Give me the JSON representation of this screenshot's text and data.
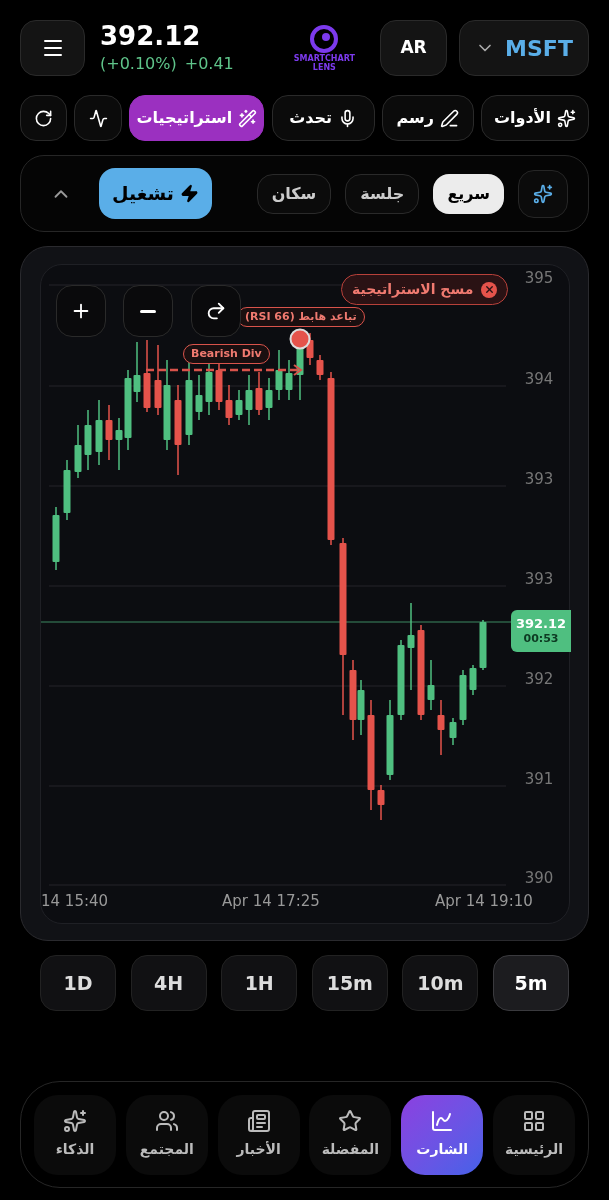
{
  "header": {
    "price": "392.12",
    "change_pct": "(+0.10%)",
    "change": "+0.41",
    "logo": [
      "SMARTCHART",
      "LENS"
    ],
    "language": "AR",
    "symbol": "MSFT"
  },
  "toolbar": [
    {
      "kind": "tools",
      "label": "الأدوات",
      "selected": false
    },
    {
      "kind": "draw",
      "label": "رسم",
      "selected": false
    },
    {
      "kind": "talk",
      "label": "تحدث",
      "selected": false
    },
    {
      "kind": "strategies",
      "label": "استراتيجيات",
      "selected": true
    },
    {
      "kind": "pulse",
      "selected": false
    },
    {
      "kind": "refresh",
      "selected": false
    }
  ],
  "modes": {
    "chips": [
      {
        "label": "سريع",
        "selected": true
      },
      {
        "label": "جلسة",
        "selected": false
      },
      {
        "label": "سكان",
        "selected": false
      }
    ],
    "run": "تشغيل",
    "expanded": true
  },
  "chart": {
    "clear_strategy": "مسح الاستراتيجية",
    "annotations": [
      {
        "kind": "divergence",
        "text": "تباعد هابط (RSI 66)"
      },
      {
        "kind": "label",
        "text": "Bearish Div"
      }
    ],
    "y_labels": [
      "395",
      "394",
      "393",
      "393",
      "392",
      "391",
      "390"
    ],
    "x_labels": [
      "Apr 14 19:10",
      "Apr 14 17:25",
      "14 15:40"
    ],
    "last_price": "392.12",
    "countdown": "00:53"
  },
  "timeframes": [
    {
      "label": "5m",
      "selected": true
    },
    {
      "label": "10m",
      "selected": false
    },
    {
      "label": "15m",
      "selected": false
    },
    {
      "label": "1H",
      "selected": false
    },
    {
      "label": "4H",
      "selected": false
    },
    {
      "label": "1D",
      "selected": false
    }
  ],
  "nav": [
    {
      "kind": "home",
      "label": "الرئيسية",
      "selected": false
    },
    {
      "kind": "chart",
      "label": "الشارت",
      "selected": true
    },
    {
      "kind": "favorites",
      "label": "المفضلة",
      "selected": false
    },
    {
      "kind": "news",
      "label": "الأخبار",
      "selected": false
    },
    {
      "kind": "community",
      "label": "المجتمع",
      "selected": false
    },
    {
      "kind": "ai",
      "label": "الذكاء",
      "selected": false
    }
  ]
}
